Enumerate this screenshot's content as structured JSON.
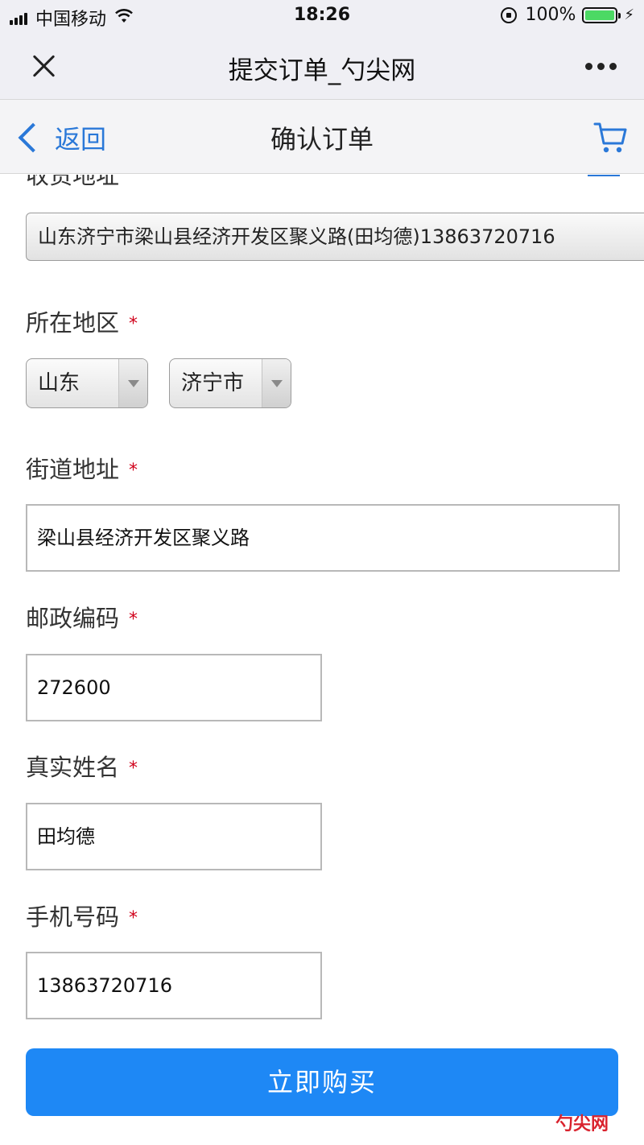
{
  "status_bar": {
    "carrier": "中国移动",
    "time": "18:26",
    "battery": "100%",
    "battery_level": 1.0
  },
  "title_bar": {
    "title": "提交订单_勺尖网",
    "close_icon": "close-icon",
    "more_icon": "more-icon"
  },
  "header": {
    "back_label": "返回",
    "title": "确认订单",
    "cart_icon": "cart-icon"
  },
  "form": {
    "address_label": "收货地址",
    "address_value": "山东济宁市梁山县经济开发区聚义路(田均德)13863720716",
    "region_label": "所在地区",
    "province": "山东",
    "city": "济宁市",
    "street_label": "街道地址",
    "street_value": "梁山县经济开发区聚义路",
    "postcode_label": "邮政编码",
    "postcode_value": "272600",
    "name_label": "真实姓名",
    "name_value": "田均德",
    "phone_label": "手机号码",
    "phone_value": "13863720716",
    "required_mark": "*"
  },
  "buy_button": "立即购买",
  "watermark": "勺尖网",
  "colors": {
    "accent": "#1e88f5",
    "link": "#2a78d8",
    "required": "#d0021b"
  }
}
